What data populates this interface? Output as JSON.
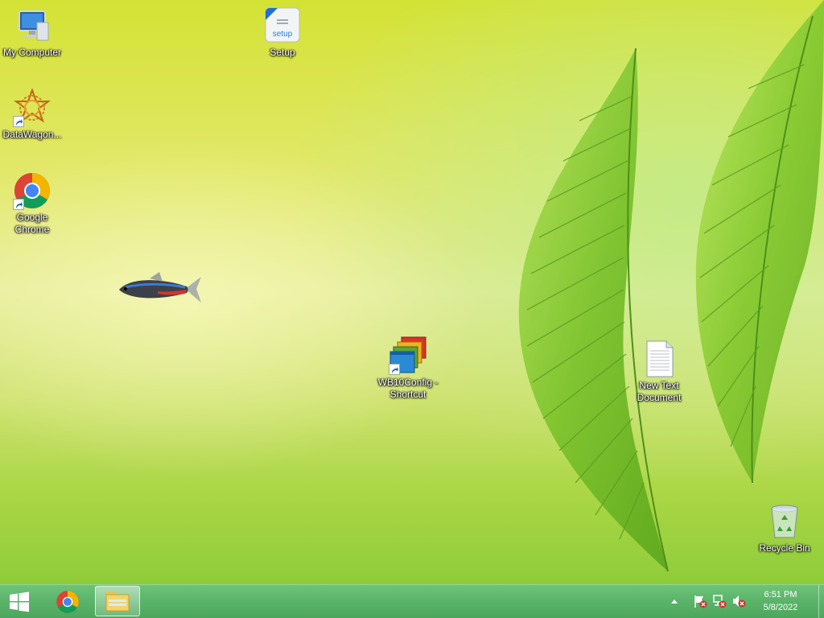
{
  "desktop_icons": {
    "my_computer": "My Computer",
    "setup": "Setup",
    "setup_logo": "setup",
    "datawagon": "DataWagon...",
    "chrome": "Google Chrome",
    "wb10config": "WB10Config - Shortcut",
    "new_text": "New Text Document",
    "recycle_bin": "Recycle Bin"
  },
  "taskbar": {
    "start": "windows-logo-icon",
    "pinned": [
      "chrome-icon",
      "file-explorer-icon"
    ],
    "tray_icons": [
      "chevron-up-icon",
      "action-center-flag-icon",
      "network-icon",
      "volume-muted-icon"
    ],
    "clock_time": "6:51 PM",
    "clock_date": "5/8/2022"
  },
  "colors": {
    "taskbar": "#5bb56a",
    "wallpaper_top": "#d4e234",
    "wallpaper_bottom": "#8fcc3a",
    "leaf": "#7cc22c"
  }
}
